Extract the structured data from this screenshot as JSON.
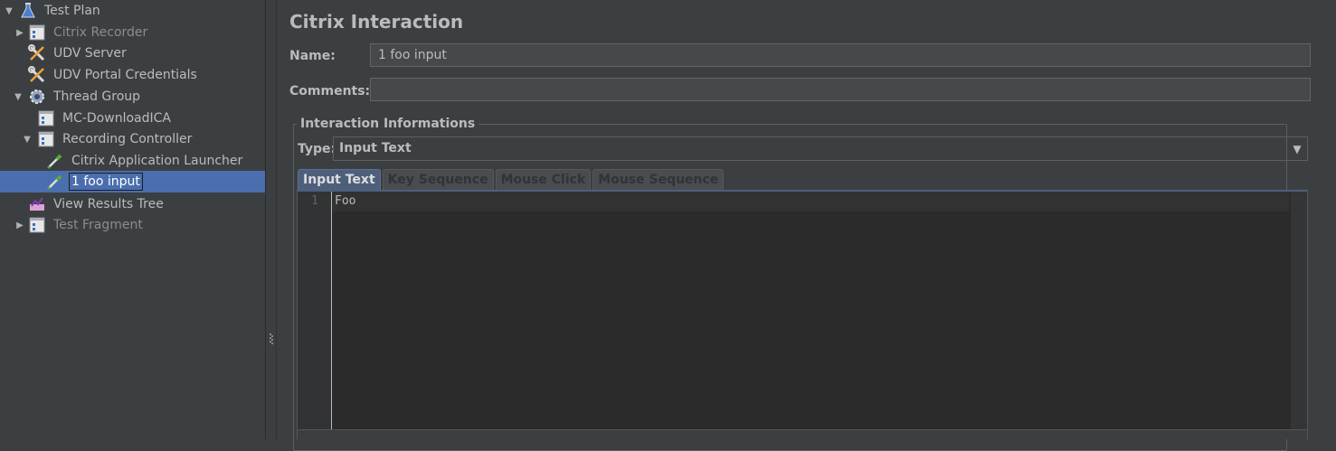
{
  "tree": {
    "items": [
      {
        "label": "Test Plan",
        "icon": "flask-icon",
        "expanded": true,
        "disabled": false
      },
      {
        "label": "Citrix Recorder",
        "icon": "controller-icon",
        "expanded": false,
        "disabled": true
      },
      {
        "label": "UDV Server",
        "icon": "wrench-screwdriver-icon",
        "disabled": false
      },
      {
        "label": "UDV Portal Credentials",
        "icon": "wrench-screwdriver-icon",
        "disabled": false
      },
      {
        "label": "Thread Group",
        "icon": "gear-icon",
        "expanded": true,
        "disabled": false
      },
      {
        "label": "MC-DownloadICA",
        "icon": "controller-icon",
        "disabled": false
      },
      {
        "label": "Recording Controller",
        "icon": "controller-icon",
        "expanded": true,
        "disabled": false
      },
      {
        "label": "Citrix Application Launcher",
        "icon": "pipette-icon",
        "disabled": false
      },
      {
        "label": "1 foo input",
        "icon": "pipette-icon",
        "selected": true,
        "disabled": false
      },
      {
        "label": "View Results Tree",
        "icon": "listener-icon",
        "disabled": false
      },
      {
        "label": "Test Fragment",
        "icon": "controller-icon",
        "expanded": false,
        "disabled": true
      }
    ]
  },
  "panel": {
    "title": "Citrix Interaction",
    "name_label": "Name:",
    "name_value": "1 foo input",
    "comments_label": "Comments:",
    "comments_value": "",
    "group_title": "Interaction Informations",
    "type_label": "Type:",
    "type_value": "Input Text",
    "tabs": [
      "Input Text",
      "Key Sequence",
      "Mouse Click",
      "Mouse Sequence"
    ],
    "active_tab": "Input Text",
    "editor": {
      "line_number": "1",
      "text": "Foo"
    }
  },
  "colors": {
    "background": "#3c3f41",
    "selection": "#4b6eaf",
    "editor_bg": "#2b2b2b"
  }
}
